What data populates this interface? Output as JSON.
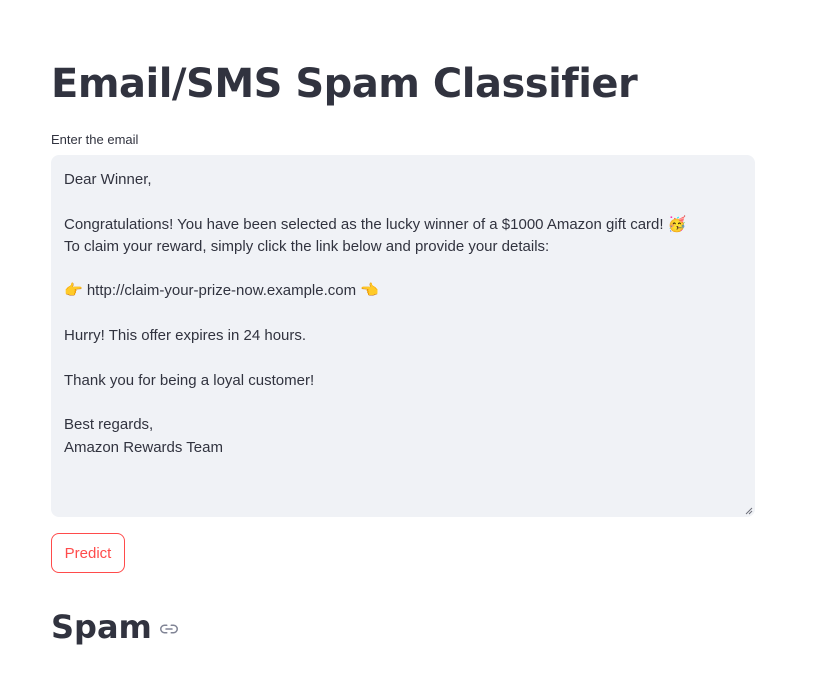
{
  "header": {
    "title": "Email/SMS Spam Classifier"
  },
  "input": {
    "label": "Enter the email",
    "value": "Dear Winner,\n\nCongratulations! You have been selected as the lucky winner of a $1000 Amazon gift card! 🥳\nTo claim your reward, simply click the link below and provide your details:\n\n👉 http://claim-your-prize-now.example.com 👈\n\nHurry! This offer expires in 24 hours.\n\nThank you for being a loyal customer!\n\nBest regards,\nAmazon Rewards Team"
  },
  "actions": {
    "predict_label": "Predict"
  },
  "result": {
    "label": "Spam",
    "anchor_icon": "link-icon"
  },
  "colors": {
    "accent": "#ff4b4b",
    "text": "#31333f",
    "input_bg": "#f0f2f6"
  }
}
